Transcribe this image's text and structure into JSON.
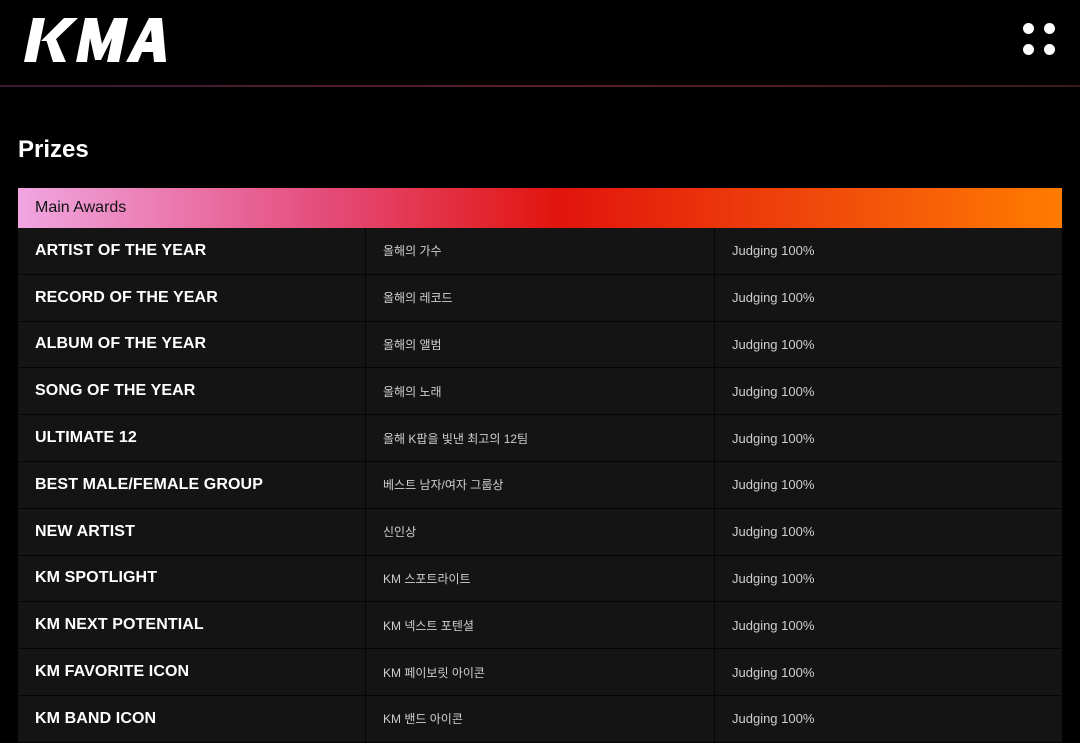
{
  "header": {
    "logo_text": "KMA",
    "menu_icon": "four-dots-menu-icon"
  },
  "page": {
    "title": "Prizes"
  },
  "section": {
    "label": "Main Awards",
    "colors": [
      "#f0a6e2",
      "#e44a78",
      "#e2140c",
      "#ff7c00"
    ]
  },
  "awards": [
    {
      "name": "ARTIST OF THE YEAR",
      "korean": "올해의 가수",
      "judging": "Judging 100%"
    },
    {
      "name": "RECORD OF THE YEAR",
      "korean": "올해의 레코드",
      "judging": "Judging 100%"
    },
    {
      "name": "ALBUM OF THE YEAR",
      "korean": "올해의 앨범",
      "judging": "Judging 100%"
    },
    {
      "name": "SONG OF THE YEAR",
      "korean": "올해의 노래",
      "judging": "Judging 100%"
    },
    {
      "name": "ULTIMATE 12",
      "korean": "올해 K팝을 빛낸 최고의 12팀",
      "judging": "Judging 100%"
    },
    {
      "name": "BEST MALE/FEMALE GROUP",
      "korean": "베스트 남자/여자 그룹상",
      "judging": "Judging 100%"
    },
    {
      "name": "NEW ARTIST",
      "korean": "신인상",
      "judging": "Judging 100%"
    },
    {
      "name": "KM SPOTLIGHT",
      "korean": "KM 스포트라이트",
      "judging": "Judging 100%"
    },
    {
      "name": "KM NEXT POTENTIAL",
      "korean": "KM 넥스트 포텐셜",
      "judging": "Judging 100%"
    },
    {
      "name": "KM FAVORITE ICON",
      "korean": "KM 페이보릿 아이콘",
      "judging": "Judging 100%"
    },
    {
      "name": "KM BAND ICON",
      "korean": "KM 밴드 아이콘",
      "judging": "Judging 100%"
    }
  ]
}
